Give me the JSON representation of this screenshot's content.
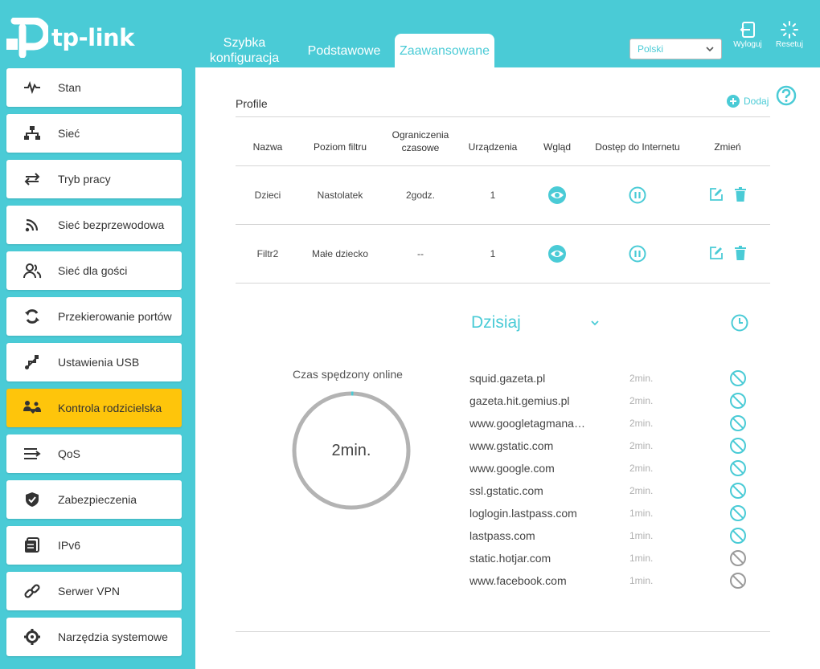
{
  "header": {
    "brand": "tp-link",
    "tabs": [
      {
        "label_line1": "Szybka",
        "label_line2": "konfiguracja"
      },
      {
        "label": "Podstawowe"
      },
      {
        "label": "Zaawansowane",
        "active": true
      }
    ],
    "language": "Polski",
    "logout_label": "Wyloguj",
    "reset_label": "Resetuj"
  },
  "sidebar": {
    "items": [
      {
        "label": "Stan",
        "icon": "pulse-icon"
      },
      {
        "label": "Sieć",
        "icon": "network-icon"
      },
      {
        "label": "Tryb pracy",
        "icon": "mode-switch-icon"
      },
      {
        "label": "Sieć bezprzewodowa",
        "icon": "wireless-icon"
      },
      {
        "label": "Sieć dla gości",
        "icon": "guests-icon"
      },
      {
        "label": "Przekierowanie portów",
        "icon": "port-forward-icon"
      },
      {
        "label": "Ustawienia USB",
        "icon": "usb-icon"
      },
      {
        "label": "Kontrola rodzicielska",
        "icon": "family-icon",
        "active": true
      },
      {
        "label": "QoS",
        "icon": "qos-icon"
      },
      {
        "label": "Zabezpieczenia",
        "icon": "shield-icon"
      },
      {
        "label": "IPv6",
        "icon": "ipv6-icon"
      },
      {
        "label": "Serwer VPN",
        "icon": "link-icon"
      },
      {
        "label": "Narzędzia systemowe",
        "icon": "gear-icon"
      }
    ]
  },
  "profiles": {
    "title": "Profile",
    "add_label": "Dodaj",
    "columns": [
      "Nazwa",
      "Poziom filtru",
      "Ograniczenia",
      "czasowe",
      "Urządzenia",
      "Wgląd",
      "Dostęp do Internetu",
      "Zmień"
    ],
    "rows": [
      {
        "name": "Dzieci",
        "filter": "Nastolatek",
        "time_limit": "2godz.",
        "devices": "1"
      },
      {
        "name": "Filtr2",
        "filter": "Małe dziecko",
        "time_limit": "--",
        "devices": "1"
      }
    ]
  },
  "insight": {
    "online_label": "Czas spędzony online",
    "online_value": "2min.",
    "period": "Dzisiaj",
    "sites": [
      {
        "domain": "squid.gazeta.pl",
        "time": "2min.",
        "blocked": false
      },
      {
        "domain": "gazeta.hit.gemius.pl",
        "time": "2min.",
        "blocked": false
      },
      {
        "domain": "www.googletagmana…",
        "time": "2min.",
        "blocked": false
      },
      {
        "domain": "www.gstatic.com",
        "time": "2min.",
        "blocked": false
      },
      {
        "domain": "www.google.com",
        "time": "2min.",
        "blocked": false
      },
      {
        "domain": "ssl.gstatic.com",
        "time": "2min.",
        "blocked": false
      },
      {
        "domain": "loglogin.lastpass.com",
        "time": "1min.",
        "blocked": false
      },
      {
        "domain": "lastpass.com",
        "time": "1min.",
        "blocked": false
      },
      {
        "domain": "static.hotjar.com",
        "time": "1min.",
        "blocked": true
      },
      {
        "domain": "www.facebook.com",
        "time": "1min.",
        "blocked": true
      }
    ]
  },
  "colors": {
    "accent": "#4acbd6",
    "active_item": "#fec50b",
    "block_gray": "#9a9a9a"
  }
}
